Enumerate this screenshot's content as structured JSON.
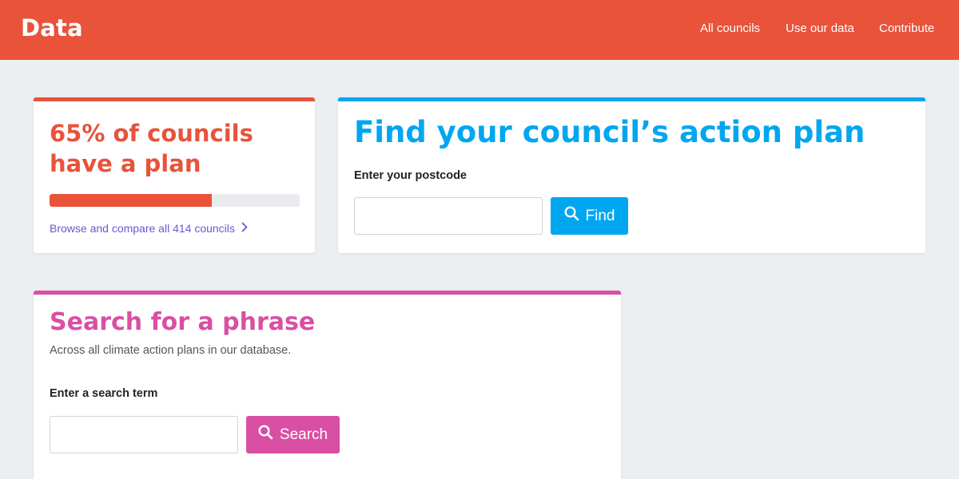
{
  "header": {
    "brand": "Data",
    "nav": [
      "All councils",
      "Use our data",
      "Contribute"
    ],
    "color": "#e8533a"
  },
  "stat_card": {
    "title": "65% of councils have a plan",
    "progress_percent": 65,
    "link": "Browse and compare all 414 councils",
    "link_icon": "chevron-right-icon",
    "accent": "#e8533a"
  },
  "find_card": {
    "title": "Find your council’s action plan",
    "label": "Enter your postcode",
    "input_value": "",
    "button": "Find",
    "button_icon": "search-icon",
    "accent": "#00a6f0"
  },
  "search_card": {
    "title": "Search for a phrase",
    "subtitle": "Across all climate action plans in our database.",
    "label": "Enter a search term",
    "input_value": "",
    "button": "Search",
    "button_icon": "search-icon",
    "accent": "#d94fa3"
  }
}
